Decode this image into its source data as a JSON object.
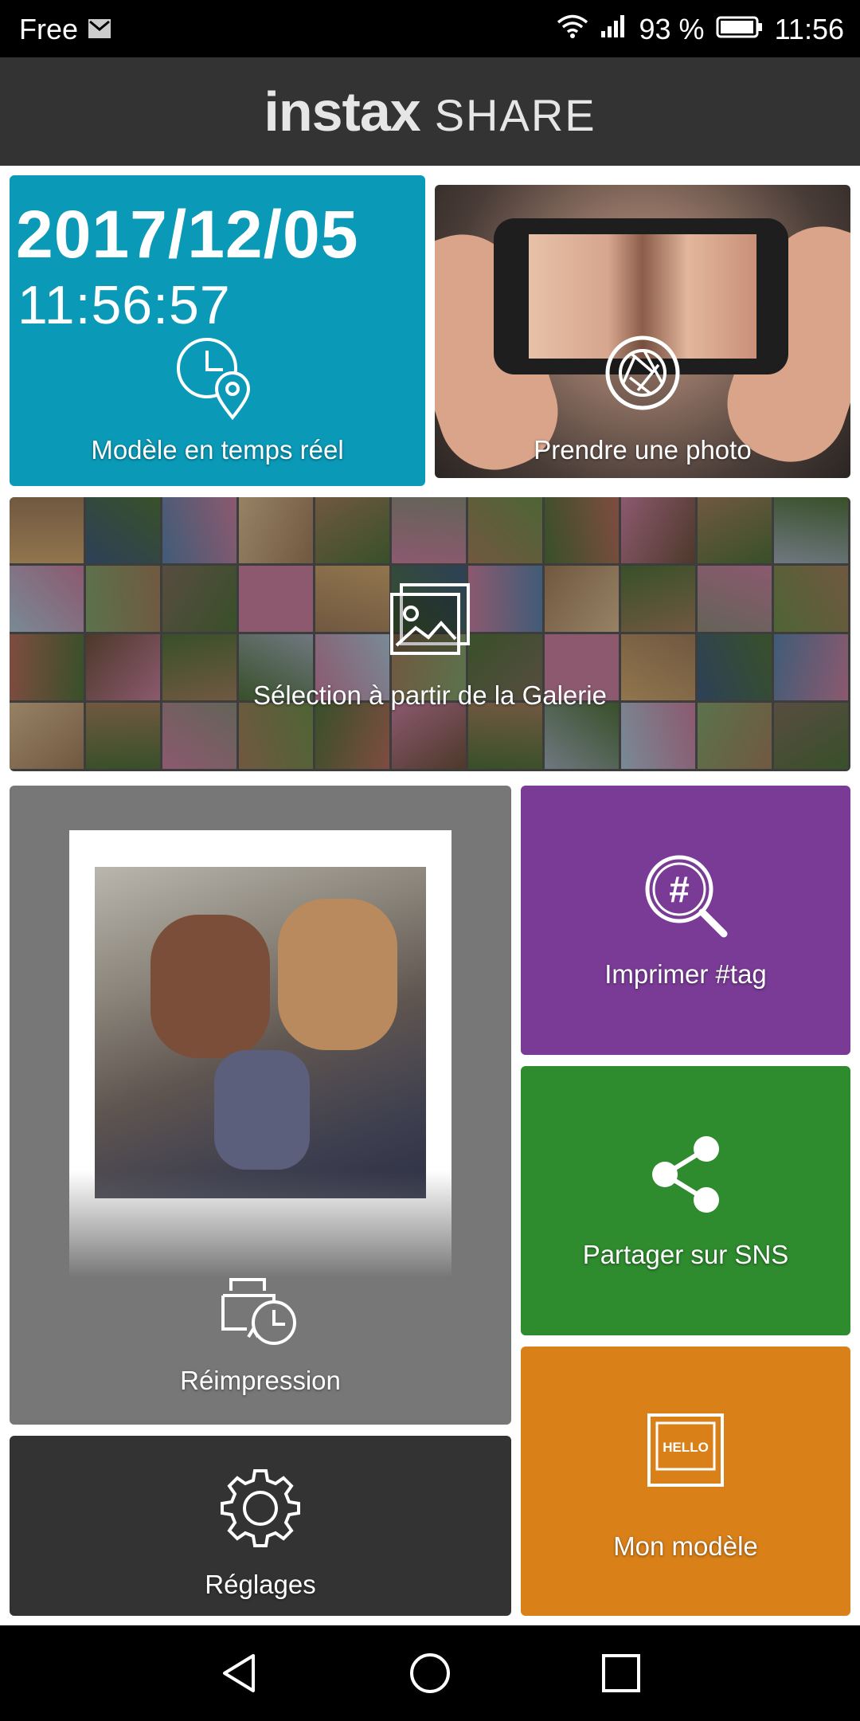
{
  "status_bar": {
    "carrier": "Free",
    "battery_percent": "93 %",
    "time": "11:56"
  },
  "app_bar": {
    "logo_bold": "instax",
    "logo_rest": "SHARE"
  },
  "tiles": {
    "realtime": {
      "date": "2017/12/05",
      "time": "11:56:57",
      "label": "Modèle en temps réel",
      "color": "#0a9ab7"
    },
    "photo": {
      "label": "Prendre une photo"
    },
    "gallery": {
      "label": "Sélection à partir de la Galerie"
    },
    "reprint": {
      "label": "Réimpression",
      "color": "#777777"
    },
    "tag": {
      "label": "Imprimer #tag",
      "icon_text": "#",
      "color": "#7a3b96"
    },
    "sns": {
      "label": "Partager sur SNS",
      "color": "#2e8b2e"
    },
    "template": {
      "label": "Mon modèle",
      "icon_text": "HELLO",
      "color": "#d98019"
    },
    "settings": {
      "label": "Réglages",
      "color": "#333333"
    }
  },
  "icons": {
    "status": [
      "mail-icon",
      "wifi-icon",
      "signal-icon",
      "battery-icon"
    ],
    "tiles": [
      "clock-location-icon",
      "camera-shutter-icon",
      "gallery-icon",
      "reprint-clock-icon",
      "hashtag-search-icon",
      "share-icon",
      "template-frame-icon",
      "gear-icon"
    ],
    "nav": [
      "back-icon",
      "home-icon",
      "recents-icon"
    ]
  }
}
